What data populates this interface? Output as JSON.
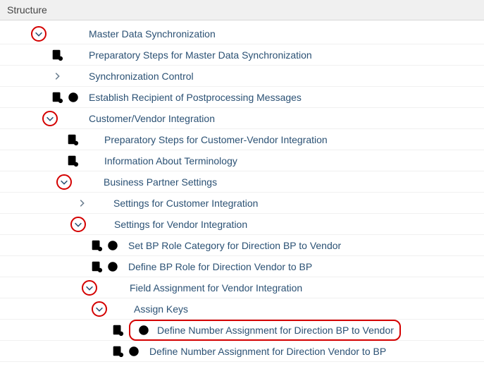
{
  "header": {
    "title": "Structure"
  },
  "tree": {
    "mds": {
      "label": "Master Data Synchronization"
    },
    "prep_mds": {
      "label": "Preparatory Steps for Master Data Synchronization"
    },
    "sync_ctrl": {
      "label": "Synchronization Control"
    },
    "est_recip": {
      "label": "Establish Recipient of Postprocessing Messages"
    },
    "cvi": {
      "label": "Customer/Vendor Integration"
    },
    "prep_cvi": {
      "label": "Preparatory Steps for Customer-Vendor Integration"
    },
    "info_term": {
      "label": "Information About Terminology"
    },
    "bps": {
      "label": "Business Partner Settings"
    },
    "settings_cust": {
      "label": "Settings for Customer Integration"
    },
    "settings_vend": {
      "label": "Settings for Vendor Integration"
    },
    "set_bp_role_cat": {
      "label": "Set BP Role Category for Direction BP to Vendor"
    },
    "def_bp_role": {
      "label": "Define BP Role for Direction Vendor to BP"
    },
    "field_assign": {
      "label": "Field Assignment for Vendor Integration"
    },
    "assign_keys": {
      "label": "Assign Keys"
    },
    "def_num_bp_vendor": {
      "label": "Define Number Assignment for Direction BP to Vendor"
    },
    "def_num_vendor_bp": {
      "label": "Define Number Assignment for Direction Vendor to BP"
    }
  }
}
